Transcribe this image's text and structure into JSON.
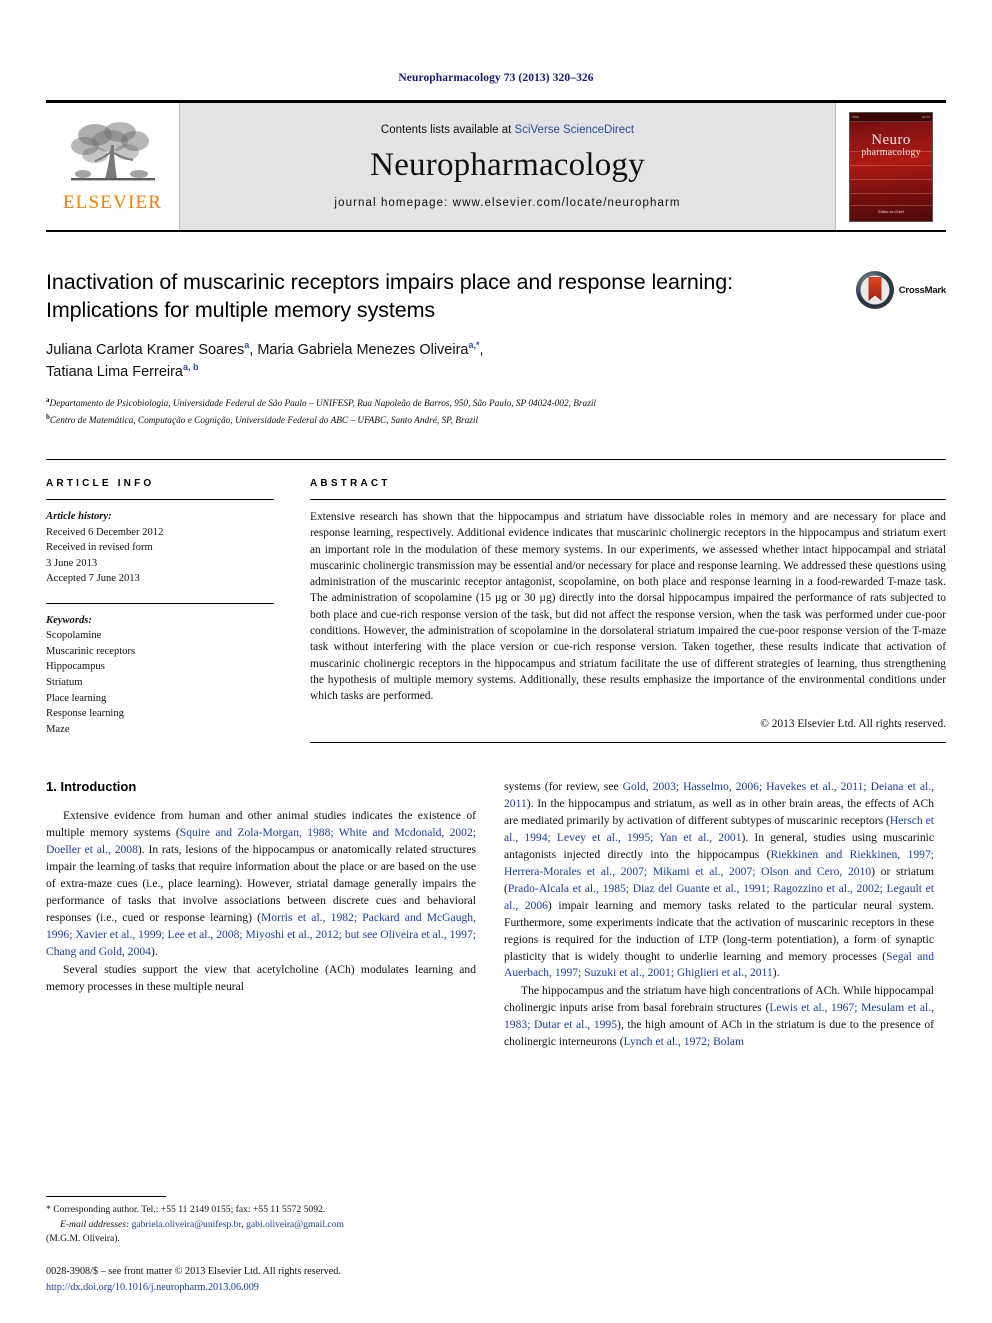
{
  "running_head": "Neuropharmacology 73 (2013) 320–326",
  "masthead": {
    "contents_prefix": "Contents lists available at ",
    "sciencedirect": "SciVerse ScienceDirect",
    "journal_name": "Neuropharmacology",
    "homepage": "journal homepage: www.elsevier.com/locate/neuropharm",
    "publisher": "ELSEVIER",
    "cover": {
      "line1": "Neuro",
      "line2": "pharmacology",
      "top_left": "ISSN",
      "top_right": "Vol 73",
      "footer": "Editor‐in‐Chief"
    },
    "accent_link_color": "#2a4fa0",
    "publisher_color": "#F08000"
  },
  "article": {
    "title": "Inactivation of muscarinic receptors impairs place and response learning: Implications for multiple memory systems",
    "authors_line1_a": "Juliana Carlota Kramer Soares",
    "authors_line1_a_sup": "a",
    "authors_line1_b": ", Maria Gabriela Menezes Oliveira",
    "authors_line1_b_sup": "a,*",
    "authors_line2": "Tatiana Lima Ferreira",
    "authors_line2_sup": "a, b",
    "affiliation_a_sup": "a",
    "affiliation_a": "Departamento de Psicobiologia, Universidade Federal de São Paulo – UNIFESP, Rua Napoleão de Barros, 950, São Paulo, SP 04024-002, Brazil",
    "affiliation_b_sup": "b",
    "affiliation_b": "Centro de Matemática, Computação e Cognição, Universidade Federal do ABC – UFABC, Santo André, SP, Brazil",
    "crossmark_label": "CrossMark"
  },
  "sections": {
    "article_info_header": "ARTICLE INFO",
    "abstract_header": "ABSTRACT",
    "history_label": "Article history:",
    "history_lines": [
      "Received 6 December 2012",
      "Received in revised form",
      "3 June 2013",
      "Accepted 7 June 2013"
    ],
    "keywords_label": "Keywords:",
    "keywords": [
      "Scopolamine",
      "Muscarinic receptors",
      "Hippocampus",
      "Striatum",
      "Place learning",
      "Response learning",
      "Maze"
    ],
    "abstract": "Extensive research has shown that the hippocampus and striatum have dissociable roles in memory and are necessary for place and response learning, respectively. Additional evidence indicates that muscarinic cholinergic receptors in the hippocampus and striatum exert an important role in the modulation of these memory systems. In our experiments, we assessed whether intact hippocampal and striatal muscarinic cholinergic transmission may be essential and/or necessary for place and response learning. We addressed these questions using administration of the muscarinic receptor antagonist, scopolamine, on both place and response learning in a food-rewarded T-maze task. The administration of scopolamine (15 µg or 30 µg) directly into the dorsal hippocampus impaired the performance of rats subjected to both place and cue-rich response version of the task, but did not affect the response version, when the task was performed under cue-poor conditions. However, the administration of scopolamine in the dorsolateral striatum impaired the cue-poor response version of the T-maze task without interfering with the place version or cue-rich response version. Taken together, these results indicate that activation of muscarinic cholinergic receptors in the hippocampus and striatum facilitate the use of different strategies of learning, thus strengthening the hypothesis of multiple memory systems. Additionally, these results emphasize the importance of the environmental conditions under which tasks are performed.",
    "abstract_copyright": "© 2013 Elsevier Ltd. All rights reserved."
  },
  "introduction": {
    "heading": "1. Introduction",
    "left_paragraphs": [
      {
        "segments": [
          {
            "t": "Extensive evidence from human and other animal studies indicates the existence of multiple memory systems (",
            "c": false
          },
          {
            "t": "Squire and Zola-Morgan, 1988; White and Mcdonald, 2002; Doeller et al., 2008",
            "c": true
          },
          {
            "t": "). In rats, lesions of the hippocampus or anatomically related structures impair the learning of tasks that require information about the place or are based on the use of extra-maze cues (i.e., place learning). However, striatal damage generally impairs the performance of tasks that involve associations between discrete cues and behavioral responses (i.e., cued or response learning) (",
            "c": false
          },
          {
            "t": "Morris et al., 1982; Packard and McGaugh, 1996; Xavier et al., 1999; Lee et al., 2008; Miyoshi et al., 2012; but see Oliveira et al., 1997; Chang and Gold, 2004",
            "c": true
          },
          {
            "t": ").",
            "c": false
          }
        ]
      },
      {
        "segments": [
          {
            "t": "Several studies support the view that acetylcholine (ACh) modulates learning and memory processes in these multiple neural",
            "c": false
          }
        ]
      }
    ],
    "right_paragraphs": [
      {
        "segments": [
          {
            "t": "systems (for review, see ",
            "c": false
          },
          {
            "t": "Gold, 2003; Hasselmo, 2006; Havekes et al., 2011; Deiana et al., 2011",
            "c": true
          },
          {
            "t": "). In the hippocampus and striatum, as well as in other brain areas, the effects of ACh are mediated primarily by activation of different subtypes of muscarinic receptors (",
            "c": false
          },
          {
            "t": "Hersch et al., 1994; Levey et al., 1995; Yan et al., 2001",
            "c": true
          },
          {
            "t": "). In general, studies using muscarinic antagonists injected directly into the hippocampus (",
            "c": false
          },
          {
            "t": "Riekkinen and Riekkinen, 1997; Herrera-Morales et al., 2007; Mikami et al., 2007; Olson and Cero, 2010",
            "c": true
          },
          {
            "t": ") or striatum (",
            "c": false
          },
          {
            "t": "Prado-Alcala et al., 1985; Diaz del Guante et al., 1991; Ragozzino et al., 2002; Legault et al., 2006",
            "c": true
          },
          {
            "t": ") impair learning and memory tasks related to the particular neural system. Furthermore, some experiments indicate that the activation of muscarinic receptors in these regions is required for the induction of LTP (long-term potentiation), a form of synaptic plasticity that is widely thought to underlie learning and memory processes (",
            "c": false
          },
          {
            "t": "Segal and Auerbach, 1997; Suzuki et al., 2001; Ghiglieri et al., 2011",
            "c": true
          },
          {
            "t": ").",
            "c": false
          }
        ]
      },
      {
        "segments": [
          {
            "t": "The hippocampus and the striatum have high concentrations of ACh. While hippocampal cholinergic inputs arise from basal forebrain structures (",
            "c": false
          },
          {
            "t": "Lewis et al., 1967; Mesulam et al., 1983; Dutar et al., 1995",
            "c": true
          },
          {
            "t": "), the high amount of ACh in the striatum is due to the presence of cholinergic interneurons (",
            "c": false
          },
          {
            "t": "Lynch et al., 1972; Bolam",
            "c": true
          }
        ]
      }
    ]
  },
  "footnotes": {
    "corresponding": "* Corresponding author. Tel.: +55 11 2149 0155; fax: +55 11 5572 5092.",
    "email_label": "E-mail addresses:",
    "email1": "gabriela.oliveira@unifesp.br",
    "email2": "gabi.oliveira@gmail.com",
    "email_suffix": "(M.G.M. Oliveira).",
    "imprint": "0028-3908/$ – see front matter © 2013 Elsevier Ltd. All rights reserved.",
    "doi": "http://dx.doi.org/10.1016/j.neuropharm.2013.06.009"
  }
}
